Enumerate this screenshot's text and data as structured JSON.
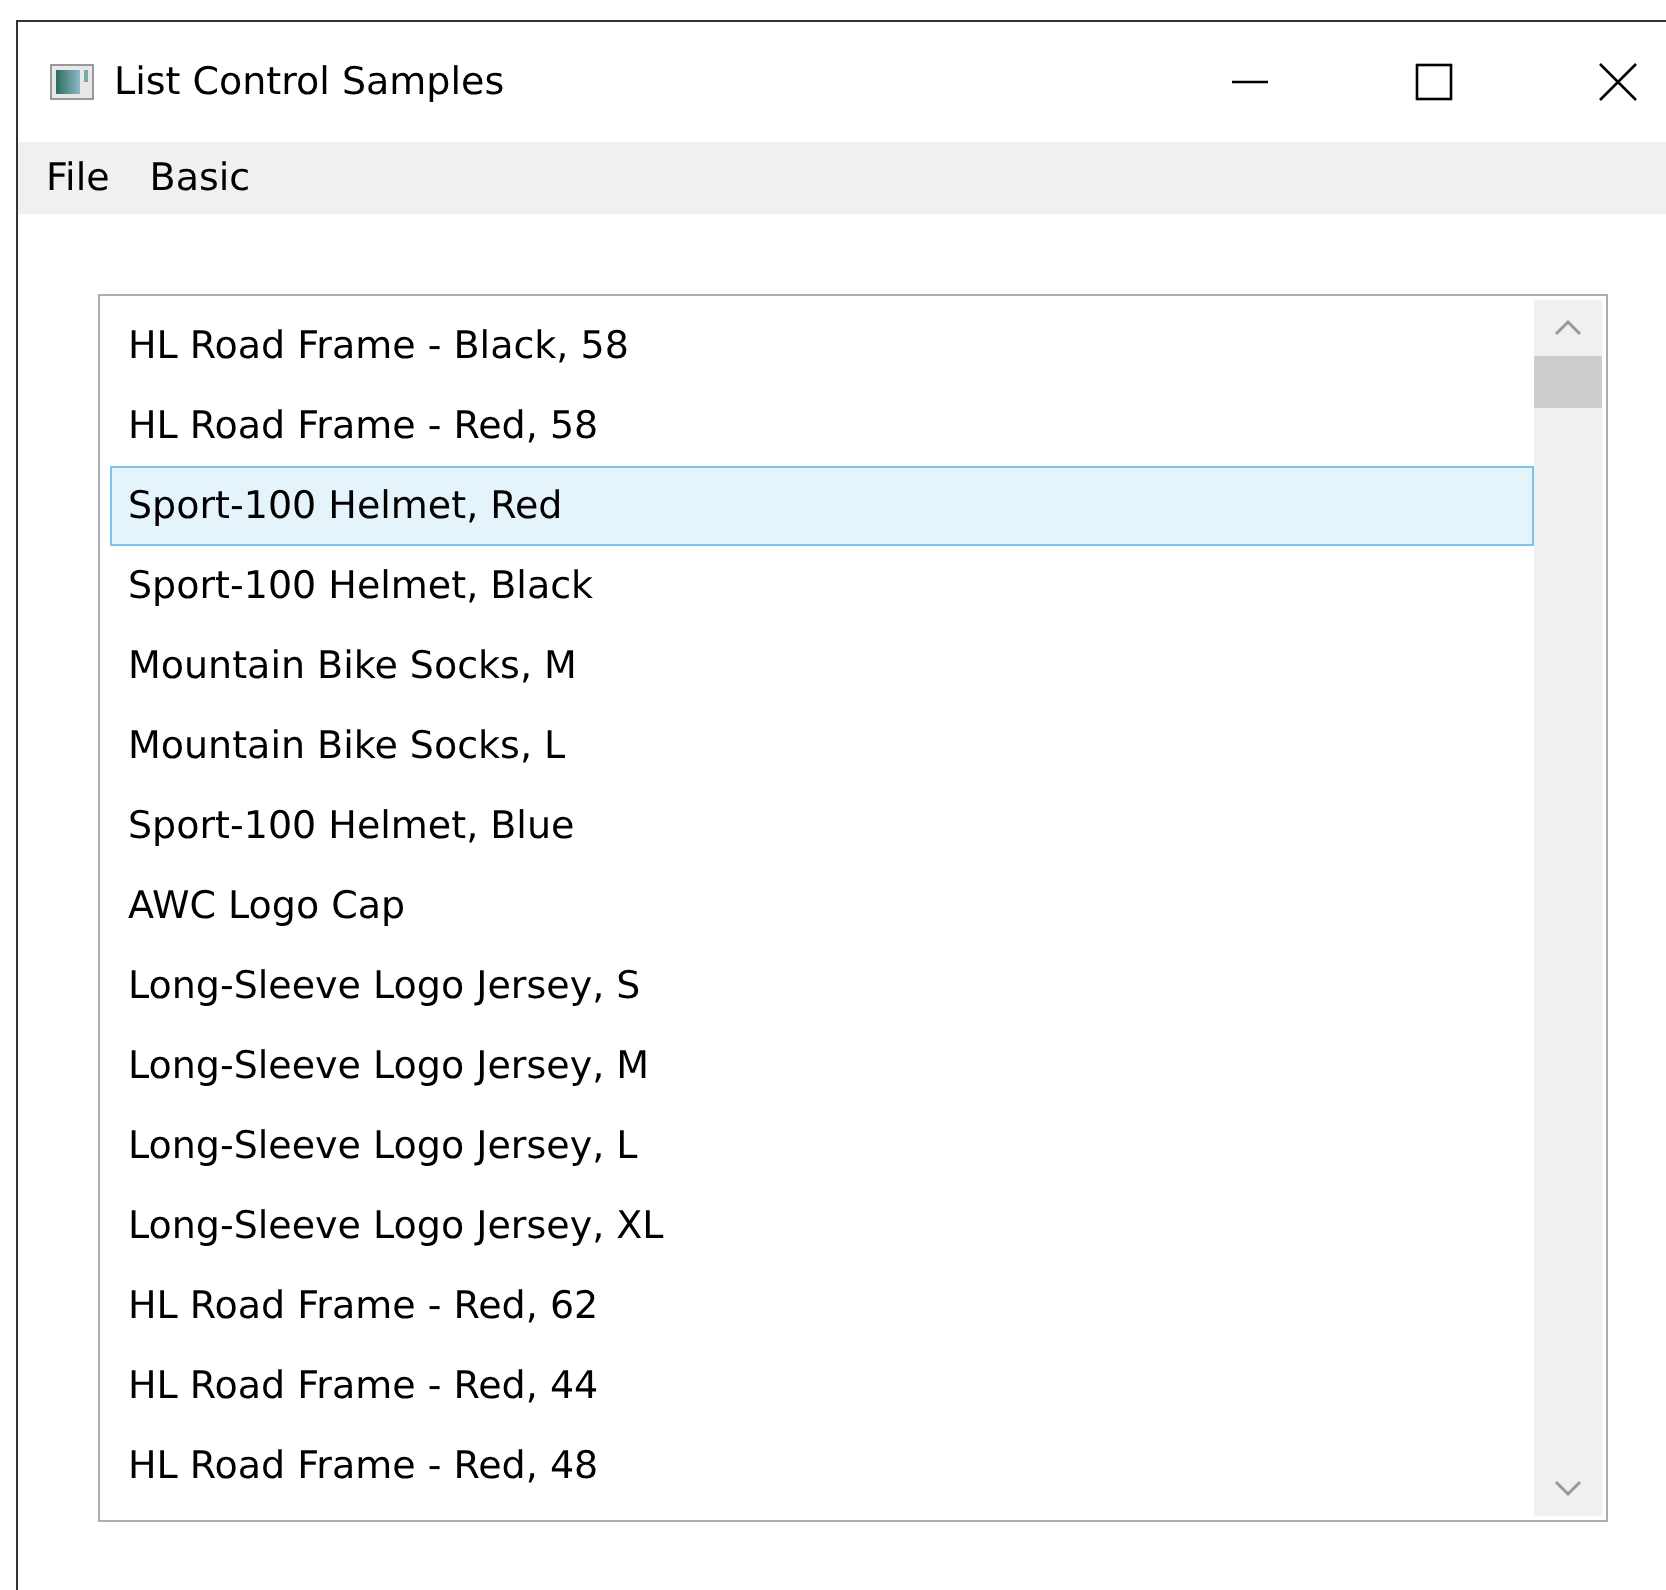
{
  "window": {
    "title": "List Control Samples"
  },
  "menu": [
    "File",
    "Basic"
  ],
  "list": {
    "items": [
      {
        "label": "HL Road Frame - Black, 58",
        "selected": false
      },
      {
        "label": "HL Road Frame - Red, 58",
        "selected": false
      },
      {
        "label": "Sport-100 Helmet, Red",
        "selected": true
      },
      {
        "label": "Sport-100 Helmet, Black",
        "selected": false
      },
      {
        "label": "Mountain Bike Socks, M",
        "selected": false
      },
      {
        "label": "Mountain Bike Socks, L",
        "selected": false
      },
      {
        "label": "Sport-100 Helmet, Blue",
        "selected": false
      },
      {
        "label": "AWC Logo Cap",
        "selected": false
      },
      {
        "label": "Long-Sleeve Logo Jersey, S",
        "selected": false
      },
      {
        "label": "Long-Sleeve Logo Jersey, M",
        "selected": false
      },
      {
        "label": "Long-Sleeve Logo Jersey, L",
        "selected": false
      },
      {
        "label": "Long-Sleeve Logo Jersey, XL",
        "selected": false
      },
      {
        "label": "HL Road Frame - Red, 62",
        "selected": false
      },
      {
        "label": "HL Road Frame - Red, 44",
        "selected": false
      },
      {
        "label": "HL Road Frame - Red, 48",
        "selected": false
      }
    ]
  }
}
